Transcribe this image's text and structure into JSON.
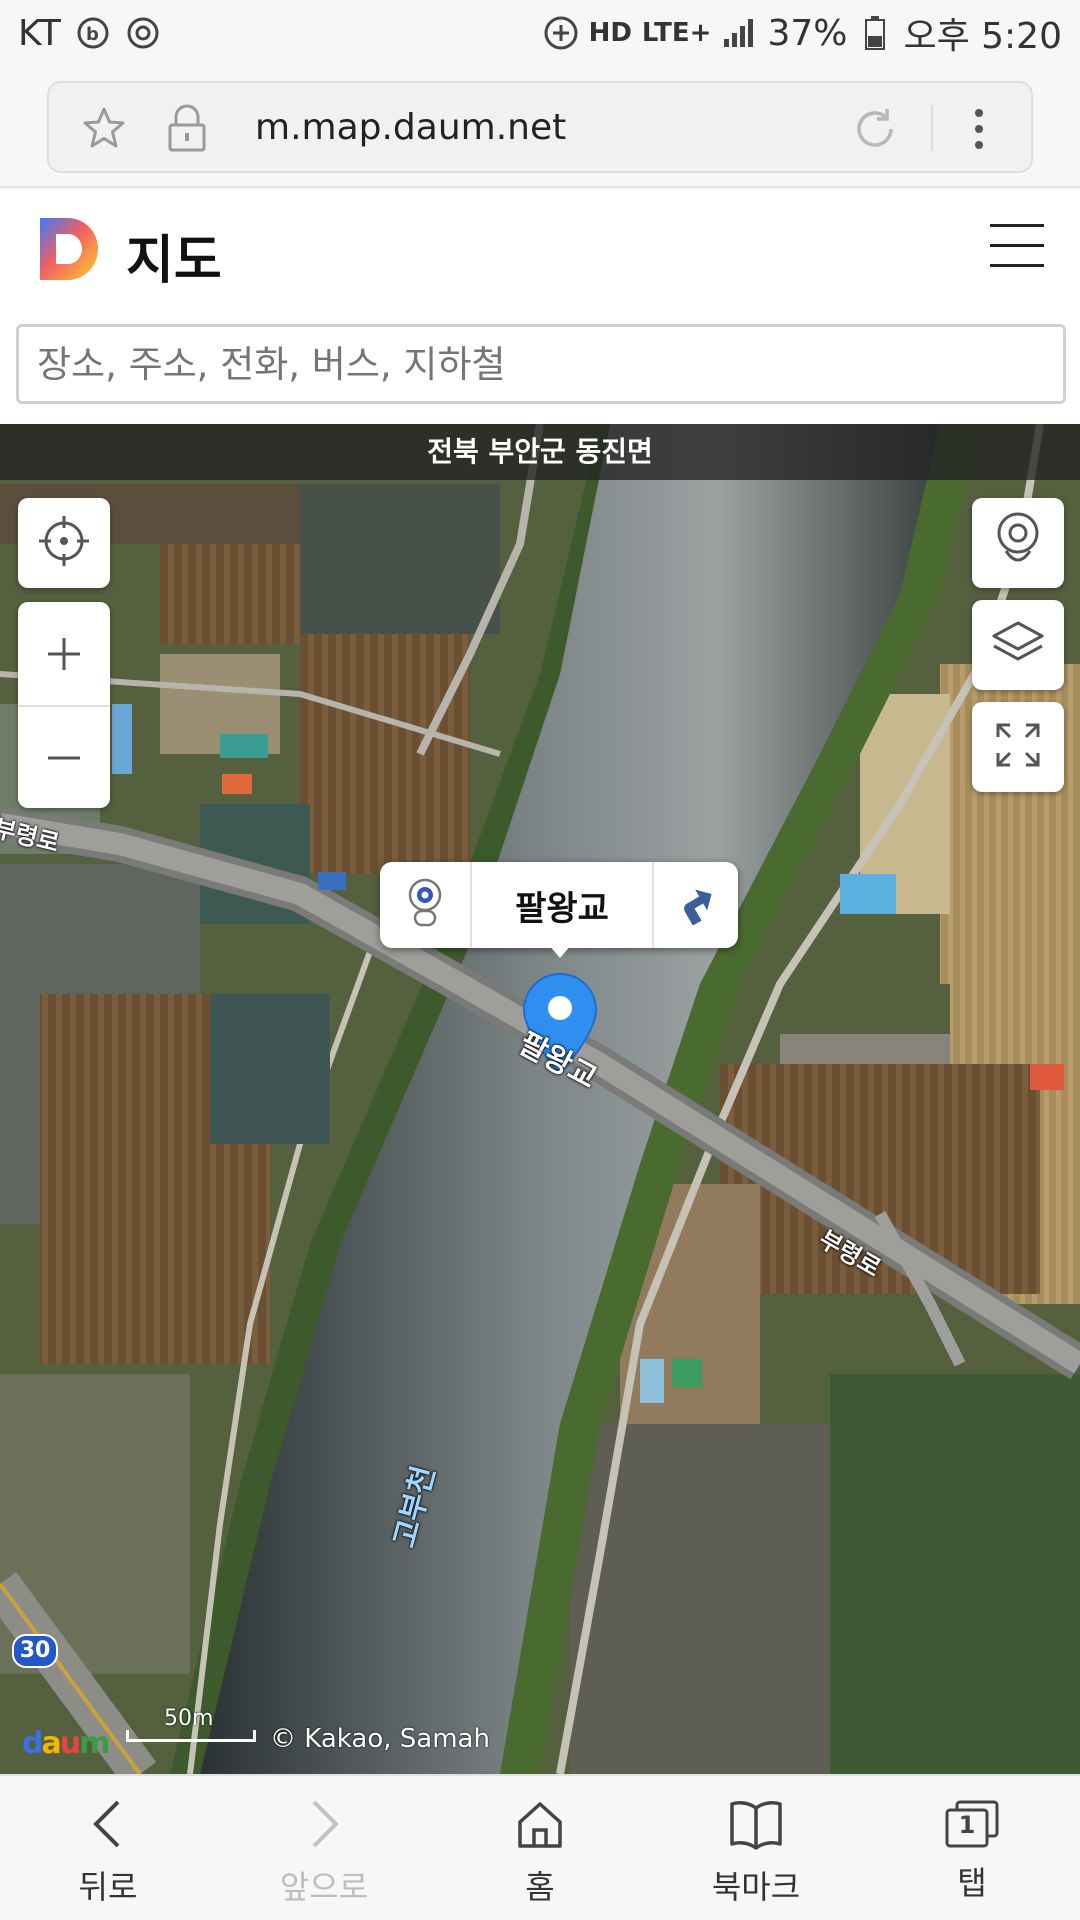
{
  "status_bar": {
    "carrier": "KT",
    "network": "LTE+",
    "hd_label": "HD",
    "battery": "37%",
    "time": "오후 5:20"
  },
  "browser": {
    "url": "m.map.daum.net"
  },
  "header": {
    "title": "지도"
  },
  "search": {
    "placeholder": "장소, 주소, 전화, 버스, 지하철"
  },
  "map": {
    "region": "전북 부안군 동진면",
    "selected_place": "팔왕교",
    "labels": {
      "bridge": "팔왕교",
      "road_left": "부령로",
      "road_right": "부령로",
      "river": "고부천",
      "route_number": "30"
    },
    "scale": "50m",
    "copyright": "© Kakao, Samah",
    "logo": "Daum"
  },
  "bottom_nav": {
    "back": "뒤로",
    "forward": "앞으로",
    "home": "홈",
    "bookmarks": "북마크",
    "tabs": "탭",
    "tab_count": "1"
  }
}
